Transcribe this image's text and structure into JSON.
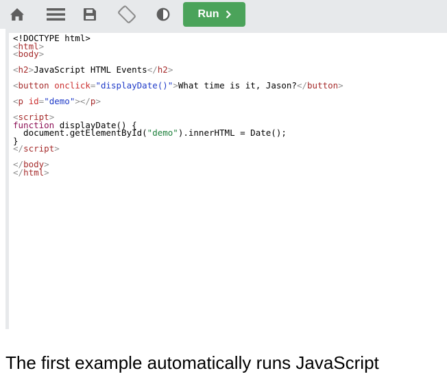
{
  "toolbar": {
    "icons": [
      "home-icon",
      "menu-icon",
      "save-icon",
      "rotate-icon",
      "contrast-icon"
    ],
    "run_label": "Run",
    "run_color": "#4ba35a",
    "background": "#e7e9eb"
  },
  "code": {
    "l1": "<!DOCTYPE html>",
    "l2_tag": "html",
    "l3_tag": "body",
    "l5_tag": "h2",
    "l5_text": "JavaScript HTML Events",
    "l7_tag": "button",
    "l7_attr": "onclick",
    "l7_val": "\"displayDate()\"",
    "l7_text": "What time is it, Jason?",
    "l9_tag": "p",
    "l9_attr": "id",
    "l9_val": "\"demo\"",
    "l11_tag": "script",
    "l12_kw": "function",
    "l12_rest": " displayDate() {",
    "l13_pre": "  document.getElementById(",
    "l13_str": "\"demo\"",
    "l13_post": ").innerHTML = Date();",
    "l14": "}",
    "l15_tag": "script",
    "l17_tag": "body",
    "l18_tag": "html"
  },
  "page": {
    "below_text": "The first example automatically runs JavaScript"
  }
}
